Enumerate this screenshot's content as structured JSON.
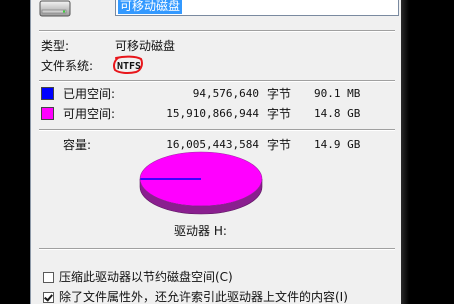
{
  "general": {
    "name_value": "可移动磁盘",
    "type_label": "类型:",
    "type_value": "可移动磁盘",
    "fs_label": "文件系统:",
    "fs_value": "NTFS",
    "fs_annotation_color": "#e8161b"
  },
  "space": {
    "used": {
      "label": "已用空间:",
      "bytes": "94,576,640",
      "unit": "字节",
      "size": "90.1 MB",
      "color": "#0000ff"
    },
    "free": {
      "label": "可用空间:",
      "bytes": "15,910,866,944",
      "unit": "字节",
      "size": "14.8 GB",
      "color": "#ff00ff"
    },
    "capacity": {
      "label": "容量:",
      "bytes": "16,005,443,584",
      "unit": "字节",
      "size": "14.9 GB"
    }
  },
  "drive_label": "驱动器 H:",
  "options": {
    "compress": {
      "label": "压缩此驱动器以节约磁盘空间(C)",
      "checked": false
    },
    "index": {
      "label": "除了文件属性外，还允许索引此驱动器上文件的内容(I)",
      "checked": true
    }
  },
  "icons": {
    "drive": "removable-drive-icon"
  }
}
